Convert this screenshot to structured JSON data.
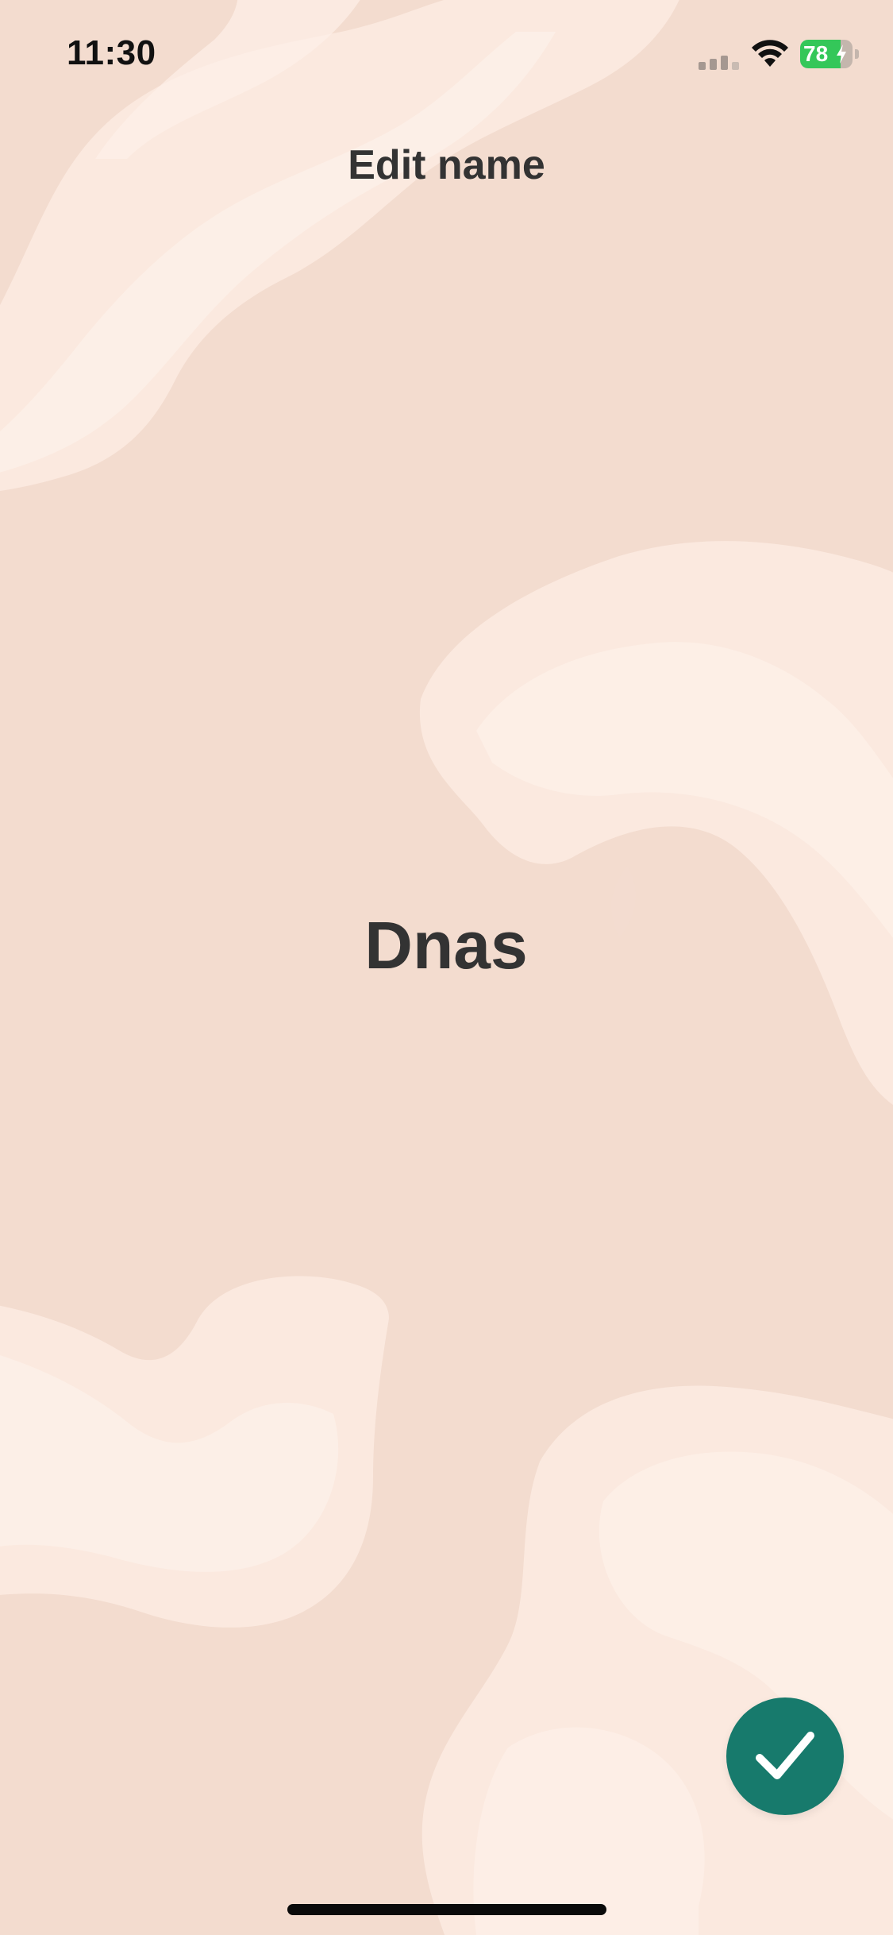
{
  "status_bar": {
    "time": "11:30",
    "battery_percent": "78",
    "battery_level": 0.78,
    "icons": [
      "signal-icon",
      "wifi-icon",
      "battery-icon",
      "charging-bolt-icon"
    ]
  },
  "header": {
    "title": "Edit name"
  },
  "form": {
    "name_value": "Dnas"
  },
  "actions": {
    "confirm_icon": "checkmark-icon"
  },
  "colors": {
    "background": "#f3dccf",
    "stroke_light": "#fbe9df",
    "accent": "#177a6c",
    "text": "#333333",
    "battery_green": "#34c759"
  }
}
